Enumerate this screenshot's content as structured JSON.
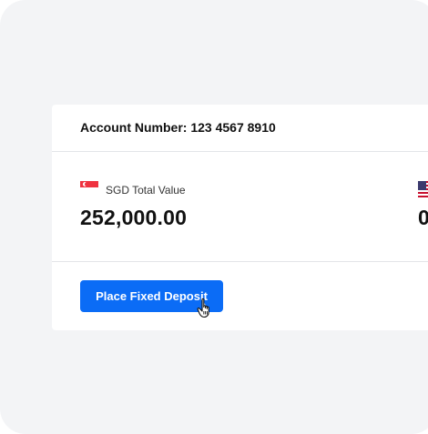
{
  "account": {
    "label": "Account Number:",
    "number": "123 4567 8910"
  },
  "balances": [
    {
      "flag_icon": "singapore-flag-icon",
      "label": "SGD Total Value",
      "value": "252,000.00"
    },
    {
      "flag_icon": "usa-flag-icon",
      "label": "",
      "value": "0"
    }
  ],
  "actions": {
    "primary_label": "Place Fixed Deposit"
  },
  "colors": {
    "primary": "#0b6cf6",
    "background": "#f3f4f6"
  }
}
